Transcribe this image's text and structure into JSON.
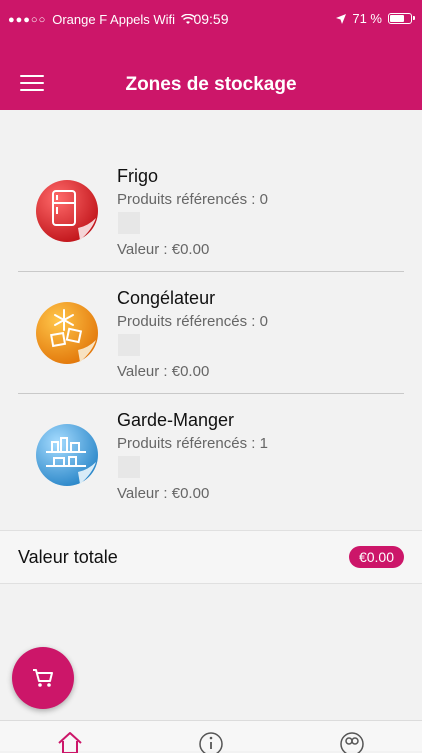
{
  "status_bar": {
    "carrier": "Orange F Appels Wifi",
    "time": "09:59",
    "battery_percent": "71 %",
    "battery_level": 0.71
  },
  "header": {
    "title": "Zones de stockage"
  },
  "zones": [
    {
      "name": "Frigo",
      "products_label": "Produits référencés : 0",
      "value_label": "Valeur : €0.00",
      "icon": "fridge-icon"
    },
    {
      "name": "Congélateur",
      "products_label": "Produits référencés : 0",
      "value_label": "Valeur : €0.00",
      "icon": "freezer-icon"
    },
    {
      "name": "Garde-Manger",
      "products_label": "Produits référencés : 1",
      "value_label": "Valeur : €0.00",
      "icon": "pantry-icon"
    }
  ],
  "total": {
    "label": "Valeur totale",
    "value": "€0.00"
  },
  "fab": {
    "icon": "cart-icon"
  },
  "bottom_nav": [
    {
      "icon": "home-icon",
      "active": true
    },
    {
      "icon": "info-icon",
      "active": false
    },
    {
      "icon": "profile-icon",
      "active": false
    }
  ],
  "colors": {
    "primary": "#cc1669",
    "fridge": "#e0262a",
    "freezer": "#f39a1a",
    "pantry": "#3a9bd8"
  }
}
